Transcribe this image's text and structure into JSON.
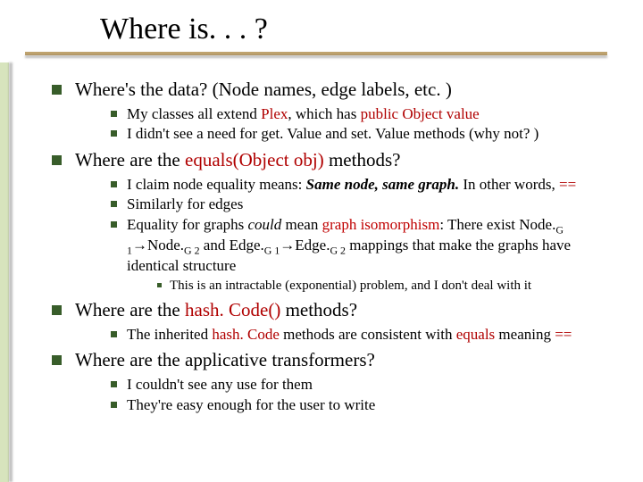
{
  "title": "Where is. . . ?",
  "b1": {
    "q": "Where's the data? (Node names, edge labels, etc. )",
    "s1_a": "My classes all extend ",
    "s1_code1": "Plex",
    "s1_b": ", which has ",
    "s1_code2": "public Object value",
    "s2": "I didn't see a need for get. Value and set. Value methods (why not? )"
  },
  "b2": {
    "q_a": "Where are the ",
    "q_code": "equals(Object obj)",
    "q_b": " methods?",
    "s1_a": "I claim node equality means: ",
    "s1_bi": "Same node, same graph.",
    "s1_b": " In other words, ",
    "s1_code": "==",
    "s2": "Similarly for edges",
    "s3_a": "Equality for graphs ",
    "s3_i": "could",
    "s3_b": " mean ",
    "s3_red": "graph isomorphism",
    "s3_c": ": There exist Node.",
    "s3_g1": "G 1",
    "s3_d": "→Node.",
    "s3_g2": "G 2",
    "s3_e": " and Edge.",
    "s3_g1b": "G 1",
    "s3_f": "→Edge.",
    "s3_g2b": "G 2",
    "s3_g": " mappings that make the graphs have identical structure",
    "ss1": "This is an intractable (exponential) problem, and I don't deal with it"
  },
  "b3": {
    "q_a": "Where are the ",
    "q_code": "hash. Code()",
    "q_b": " methods?",
    "s1_a": "The inherited ",
    "s1_code1": "hash. Code",
    "s1_b": " methods are consistent with ",
    "s1_code2": "equals",
    "s1_c": " meaning ",
    "s1_code3": "=="
  },
  "b4": {
    "q": "Where are the applicative transformers?",
    "s1": "I couldn't see any use for them",
    "s2": "They're easy enough for the user to write"
  }
}
